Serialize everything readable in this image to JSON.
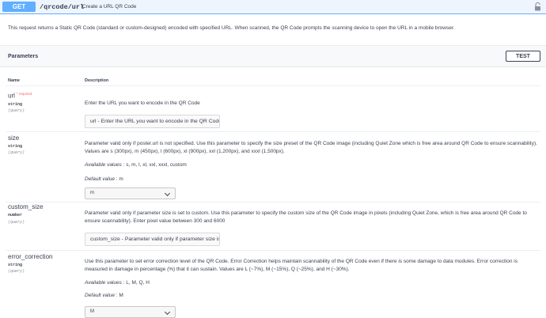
{
  "summary": {
    "method": "GET",
    "path": "/qrcode/url",
    "text": "Create a URL QR Code",
    "lock_icon": "lock-open-icon"
  },
  "description": "This request returns a Static QR Code (standard or custom-designed) encoded with specified URL. When scanned, the QR Code prompts the scanning device to open the URL in a mobile browser.",
  "parameters_section": {
    "title": "Parameters",
    "test_label": "TEST",
    "col_name": "Name",
    "col_description": "Description"
  },
  "params": {
    "url": {
      "name": "url",
      "required": "* required",
      "type": "string",
      "in": "(query)",
      "description": "Enter the URL you want to encode in the QR Code",
      "placeholder": "url - Enter the URL you want to encode in the QR Code"
    },
    "size": {
      "name": "size",
      "type": "string",
      "in": "(query)",
      "description": "Parameter valid only if poster.url is not specified. Use this parameter to specify the size preset of the QR Code image (including Quiet Zone which is free area around QR Code to ensure scannability). Values are s (300px), m (450px), l (600px), xl (900px), xxl (1,200px), and xxxl (1,500px).",
      "available_label": "Available values",
      "available_values": "s, m, l, xl, xxl, xxxl, custom",
      "default_label": "Default value",
      "default_value": "m",
      "selected": "m"
    },
    "custom_size": {
      "name": "custom_size",
      "type": "number",
      "in": "(query)",
      "description": "Parameter valid only if parameter size is set to custom. Use this parameter to specify the custom size of the QR Code image in pixels (including Quiet Zone, which is free area around QR Code to ensure scannability). Enter pixel value between 300 and 6000",
      "placeholder": "custom_size - Parameter valid only if parameter size is set to custom"
    },
    "error_correction": {
      "name": "error_correction",
      "type": "string",
      "in": "(query)",
      "description": "Use this parameter to set error correction level of the QR Code. Error Correction helps maintain scannability of the QR Code even if there is some damage to data modules. Error correction is measured in damage in percentage (%) that it can sustain. Values are L (~7%), M (~15%), Q (~25%), and H (~30%).",
      "available_label": "Available values",
      "available_values": "L, M, Q, H",
      "default_label": "Default value",
      "default_value": "M",
      "selected": "M"
    }
  },
  "colors": {
    "method_bg": "#61affe",
    "summary_bg": "#eef5fe",
    "required": "#ff6060",
    "text": "#3b4151"
  }
}
